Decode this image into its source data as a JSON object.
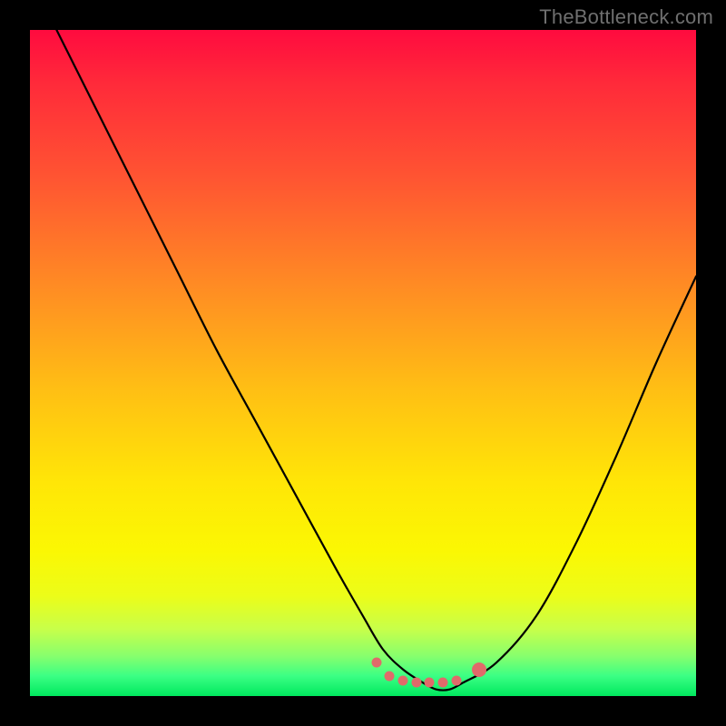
{
  "watermark": {
    "text": "TheBottleneck.com"
  },
  "colors": {
    "background": "#000000",
    "curve": "#000000",
    "marker": "#e06a6a",
    "watermark": "#6f6f6f"
  },
  "chart_data": {
    "type": "line",
    "title": "",
    "xlabel": "",
    "ylabel": "",
    "xlim": [
      0,
      100
    ],
    "ylim": [
      0,
      100
    ],
    "grid": false,
    "legend": false,
    "series": [
      {
        "name": "bottleneck-curve",
        "x": [
          4,
          10,
          16,
          22,
          28,
          34,
          40,
          46,
          50,
          53,
          56,
          59,
          61,
          63,
          65,
          70,
          76,
          82,
          88,
          94,
          100
        ],
        "y": [
          100,
          88,
          76,
          64,
          52,
          41,
          30,
          19,
          12,
          7,
          4,
          2,
          1,
          1,
          2,
          5,
          12,
          23,
          36,
          50,
          63
        ]
      }
    ],
    "markers": [
      {
        "name": "optimal-start",
        "x": 52,
        "y": 5,
        "size": "small"
      },
      {
        "name": "optimal-a",
        "x": 54,
        "y": 3,
        "size": "small"
      },
      {
        "name": "optimal-b",
        "x": 56,
        "y": 2.3,
        "size": "small"
      },
      {
        "name": "optimal-c",
        "x": 58,
        "y": 2,
        "size": "small"
      },
      {
        "name": "optimal-d",
        "x": 60,
        "y": 2,
        "size": "small"
      },
      {
        "name": "optimal-e",
        "x": 62,
        "y": 2,
        "size": "small"
      },
      {
        "name": "optimal-f",
        "x": 64,
        "y": 2.3,
        "size": "small"
      },
      {
        "name": "optimal-end",
        "x": 67.5,
        "y": 4,
        "size": "large"
      }
    ]
  }
}
